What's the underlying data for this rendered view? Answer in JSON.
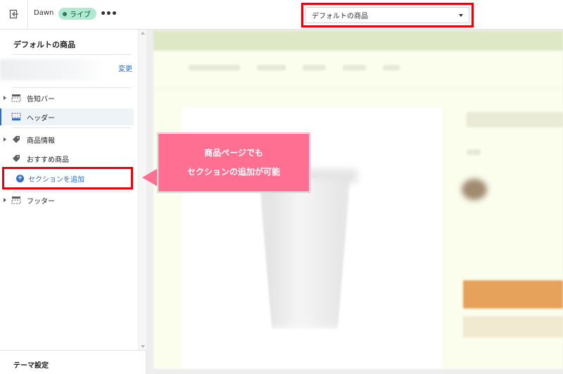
{
  "topbar": {
    "theme_name": "Dawn",
    "live_badge": "ライブ",
    "more_label": "•••",
    "template_select": {
      "value": "デフォルトの商品"
    }
  },
  "sidebar": {
    "title": "デフォルトの商品",
    "change_link": "変更",
    "items": [
      {
        "label": "告知バー",
        "icon": "announcement-bar-icon",
        "expandable": true
      },
      {
        "label": "ヘッダー",
        "icon": "header-icon",
        "expandable": false,
        "selected": true
      },
      {
        "label": "商品情報",
        "icon": "tag-icon",
        "expandable": true
      },
      {
        "label": "おすすめ商品",
        "icon": "tag-icon",
        "expandable": false
      }
    ],
    "add_section_label": "セクションを追加",
    "footer_item": {
      "label": "フッター",
      "icon": "footer-icon",
      "expandable": true
    },
    "theme_settings_label": "テーマ設定"
  },
  "callout": {
    "line1": "商品ページでも",
    "line2": "セクションの追加が可能"
  },
  "colors": {
    "accent_blue": "#2c6ecb",
    "highlight_red": "#e8000b",
    "callout_pink": "#ff6f92",
    "live_badge_bg": "#aee9d1"
  }
}
